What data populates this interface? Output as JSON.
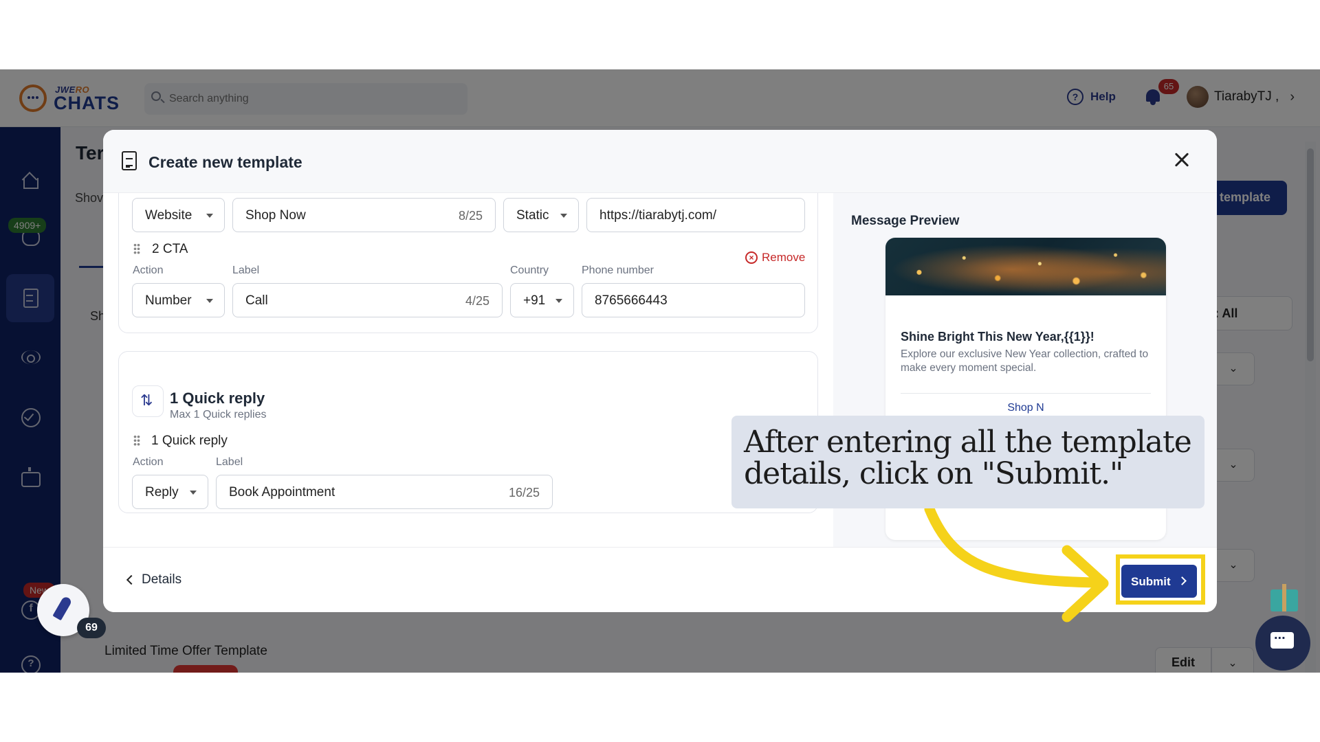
{
  "app": {
    "logo_small_prefix": "JWE",
    "logo_small_accent": "RO",
    "logo_big": "CHATS",
    "search_placeholder": "Search anything",
    "help_label": "Help",
    "notification_count": "65",
    "user_name": "TiarabyTJ ,",
    "sidebar_badge_count": "4909+",
    "sidebar_new_badge": "New",
    "page_title_partial": "Ter",
    "page_sub_partial": "Shov",
    "create_button_partial": "template",
    "section_partial": "Sh",
    "filter_partial": ": All",
    "list_item_title": "Limited Time Offer Template",
    "edit_label": "Edit",
    "rocket_badge_count": "69"
  },
  "modal": {
    "title": "Create new template",
    "cta_row_1": {
      "action": "Website",
      "label": "Shop Now",
      "label_count": "8/25",
      "url_type": "Static",
      "url": "https://tiarabytj.com/"
    },
    "cta_row_2": {
      "title": "2 CTA",
      "remove_label": "Remove",
      "action_label": "Action",
      "label_label": "Label",
      "country_label": "Country",
      "phone_label": "Phone number",
      "action": "Number",
      "label": "Call",
      "label_count": "4/25",
      "country_code": "+91",
      "phone": "8765666443"
    },
    "quick_reply_section": {
      "title": "1 Quick reply",
      "subtitle": "Max 1 Quick replies",
      "row_title": "1 Quick reply",
      "action_label": "Action",
      "label_label": "Label",
      "action": "Reply",
      "label": "Book Appointment",
      "label_count": "16/25"
    },
    "preview": {
      "title": "Message Preview",
      "message_title": "Shine Bright This New Year,{{1}}!",
      "message_body": "Explore our exclusive New Year collection, crafted to make every moment special.",
      "button_partial": "Shop N"
    },
    "footer": {
      "back_label": "Details",
      "submit_label": "Submit"
    }
  },
  "tutorial": {
    "callout_text": "After entering all the template details, click on \"Submit.\"",
    "highlight_color": "#f5d21a"
  },
  "colors": {
    "brand": "#1f3a93",
    "sidebar": "#0e2266",
    "danger": "#c62828"
  }
}
